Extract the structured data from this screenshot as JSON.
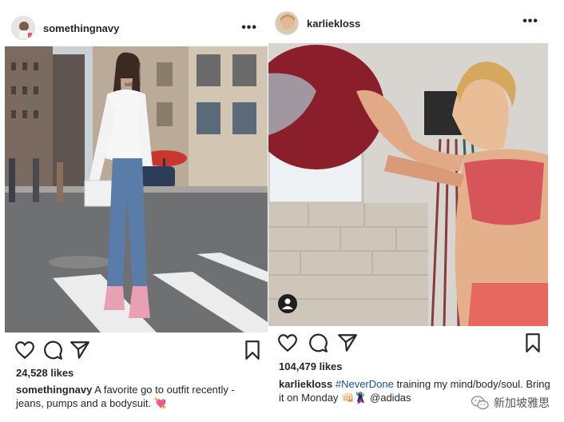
{
  "posts": [
    {
      "username": "somethingnavy",
      "more": "•••",
      "likes": "24,528 likes",
      "caption_user": "somethingnavy",
      "caption_text": "A favorite go to outfit recently - jeans, pumps and a bodysuit. 💘"
    },
    {
      "username": "karliekloss",
      "more": "•••",
      "likes": "104,479 likes",
      "caption_user": "karliekloss",
      "caption_tag": "#NeverDone",
      "caption_text": "training my mind/body/soul. Bring it on Monday 👊🏻🦹 @adidas"
    }
  ],
  "watermark": {
    "text": "新加坡雅思"
  },
  "icons": [
    "heart-icon",
    "comment-icon",
    "share-icon",
    "bookmark-icon",
    "more-icon",
    "user-tag-icon",
    "wechat-icon"
  ]
}
